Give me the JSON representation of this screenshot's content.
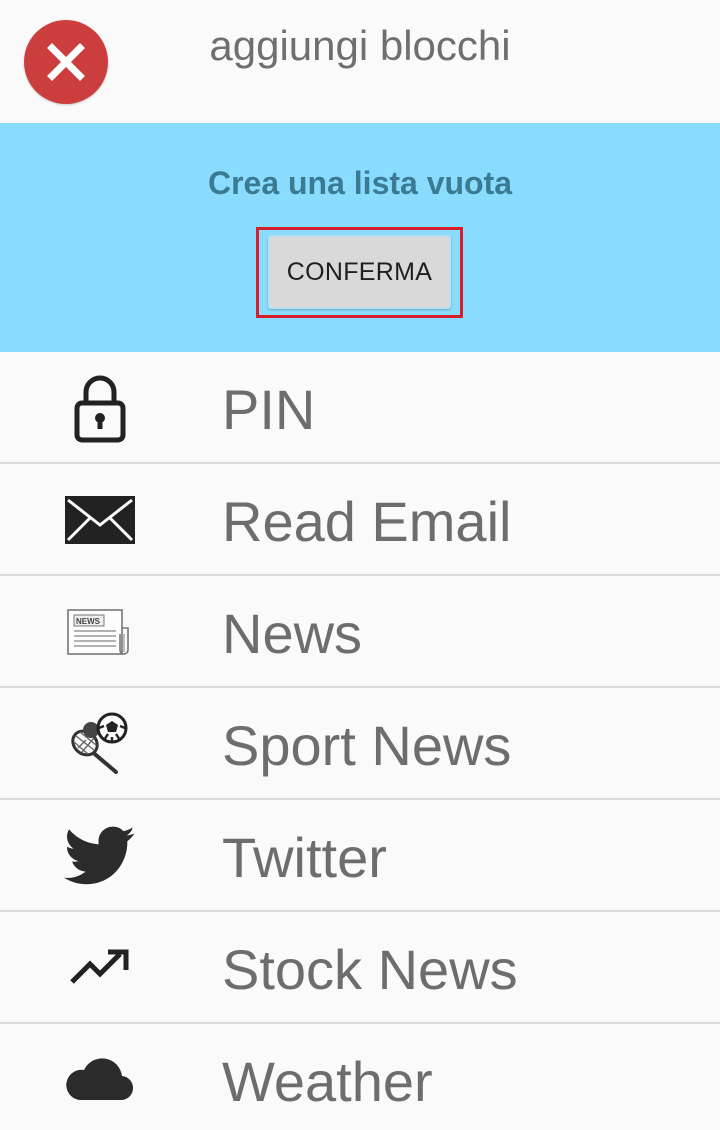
{
  "header": {
    "title": "aggiungi blocchi"
  },
  "banner": {
    "text": "Crea una lista vuota",
    "confirm_label": "CONFERMA",
    "background": "#8adcff"
  },
  "items": [
    {
      "label": "PIN",
      "icon": "lock-icon"
    },
    {
      "label": "Read Email",
      "icon": "envelope-icon"
    },
    {
      "label": "News",
      "icon": "newspaper-icon"
    },
    {
      "label": "Sport News",
      "icon": "sport-balls-icon"
    },
    {
      "label": "Twitter",
      "icon": "twitter-bird-icon"
    },
    {
      "label": "Stock News",
      "icon": "trending-up-icon"
    },
    {
      "label": "Weather",
      "icon": "cloud-icon"
    }
  ],
  "colors": {
    "close_button": "#cc3e3e",
    "highlight_outline": "#d8202c",
    "text": "#6d6d6d"
  }
}
